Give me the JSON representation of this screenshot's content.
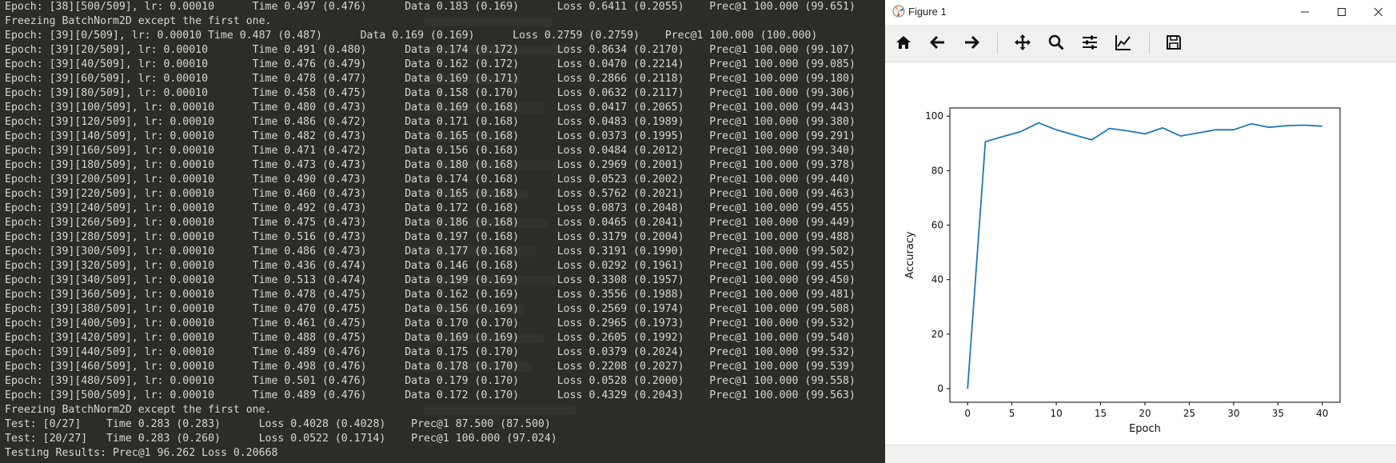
{
  "terminal": {
    "lines": [
      "Epoch: [38][500/509], lr: 0.00010      Time 0.497 (0.476)      Data 0.183 (0.169)      Loss 0.6411 (0.2055)    Prec@1 100.000 (99.651)",
      "Freezing BatchNorm2D except the first one.",
      "Epoch: [39][0/509], lr: 0.00010 Time 0.487 (0.487)      Data 0.169 (0.169)      Loss 0.2759 (0.2759)    Prec@1 100.000 (100.000)",
      "Epoch: [39][20/509], lr: 0.00010       Time 0.491 (0.480)      Data 0.174 (0.172)      Loss 0.8634 (0.2170)    Prec@1 100.000 (99.107)",
      "Epoch: [39][40/509], lr: 0.00010       Time 0.476 (0.479)      Data 0.162 (0.172)      Loss 0.0470 (0.2214)    Prec@1 100.000 (99.085)",
      "Epoch: [39][60/509], lr: 0.00010       Time 0.478 (0.477)      Data 0.169 (0.171)      Loss 0.2866 (0.2118)    Prec@1 100.000 (99.180)",
      "Epoch: [39][80/509], lr: 0.00010       Time 0.458 (0.475)      Data 0.158 (0.170)      Loss 0.0632 (0.2117)    Prec@1 100.000 (99.306)",
      "Epoch: [39][100/509], lr: 0.00010      Time 0.480 (0.473)      Data 0.169 (0.168)      Loss 0.0417 (0.2065)    Prec@1 100.000 (99.443)",
      "Epoch: [39][120/509], lr: 0.00010      Time 0.486 (0.472)      Data 0.171 (0.168)      Loss 0.0483 (0.1989)    Prec@1 100.000 (99.380)",
      "Epoch: [39][140/509], lr: 0.00010      Time 0.482 (0.473)      Data 0.165 (0.168)      Loss 0.0373 (0.1995)    Prec@1 100.000 (99.291)",
      "Epoch: [39][160/509], lr: 0.00010      Time 0.471 (0.472)      Data 0.156 (0.168)      Loss 0.0484 (0.2012)    Prec@1 100.000 (99.340)",
      "Epoch: [39][180/509], lr: 0.00010      Time 0.473 (0.473)      Data 0.180 (0.168)      Loss 0.2969 (0.2001)    Prec@1 100.000 (99.378)",
      "Epoch: [39][200/509], lr: 0.00010      Time 0.490 (0.473)      Data 0.174 (0.168)      Loss 0.0523 (0.2002)    Prec@1 100.000 (99.440)",
      "Epoch: [39][220/509], lr: 0.00010      Time 0.460 (0.473)      Data 0.165 (0.168)      Loss 0.5762 (0.2021)    Prec@1 100.000 (99.463)",
      "Epoch: [39][240/509], lr: 0.00010      Time 0.492 (0.473)      Data 0.172 (0.168)      Loss 0.0873 (0.2048)    Prec@1 100.000 (99.455)",
      "Epoch: [39][260/509], lr: 0.00010      Time 0.475 (0.473)      Data 0.186 (0.168)      Loss 0.0465 (0.2041)    Prec@1 100.000 (99.449)",
      "Epoch: [39][280/509], lr: 0.00010      Time 0.516 (0.473)      Data 0.197 (0.168)      Loss 0.3179 (0.2004)    Prec@1 100.000 (99.488)",
      "Epoch: [39][300/509], lr: 0.00010      Time 0.486 (0.473)      Data 0.177 (0.168)      Loss 0.3191 (0.1990)    Prec@1 100.000 (99.502)",
      "Epoch: [39][320/509], lr: 0.00010      Time 0.436 (0.474)      Data 0.146 (0.168)      Loss 0.0292 (0.1961)    Prec@1 100.000 (99.455)",
      "Epoch: [39][340/509], lr: 0.00010      Time 0.513 (0.474)      Data 0.199 (0.169)      Loss 0.3308 (0.1957)    Prec@1 100.000 (99.450)",
      "Epoch: [39][360/509], lr: 0.00010      Time 0.478 (0.475)      Data 0.162 (0.169)      Loss 0.3556 (0.1988)    Prec@1 100.000 (99.481)",
      "Epoch: [39][380/509], lr: 0.00010      Time 0.470 (0.475)      Data 0.156 (0.169)      Loss 0.2569 (0.1974)    Prec@1 100.000 (99.508)",
      "Epoch: [39][400/509], lr: 0.00010      Time 0.461 (0.475)      Data 0.170 (0.170)      Loss 0.2965 (0.1973)    Prec@1 100.000 (99.532)",
      "Epoch: [39][420/509], lr: 0.00010      Time 0.488 (0.475)      Data 0.169 (0.169)      Loss 0.2605 (0.1992)    Prec@1 100.000 (99.540)",
      "Epoch: [39][440/509], lr: 0.00010      Time 0.489 (0.476)      Data 0.175 (0.170)      Loss 0.0379 (0.2024)    Prec@1 100.000 (99.532)",
      "Epoch: [39][460/509], lr: 0.00010      Time 0.498 (0.476)      Data 0.178 (0.170)      Loss 0.2208 (0.2027)    Prec@1 100.000 (99.539)",
      "Epoch: [39][480/509], lr: 0.00010      Time 0.501 (0.476)      Data 0.179 (0.170)      Loss 0.0528 (0.2000)    Prec@1 100.000 (99.558)",
      "Epoch: [39][500/509], lr: 0.00010      Time 0.489 (0.476)      Data 0.172 (0.170)      Loss 0.4329 (0.2043)    Prec@1 100.000 (99.563)",
      "Freezing BatchNorm2D except the first one.",
      "Test: [0/27]    Time 0.283 (0.283)      Loss 0.4028 (0.4028)    Prec@1 87.500 (87.500)",
      "Test: [20/27]   Time 0.283 (0.260)      Loss 0.0522 (0.1714)    Prec@1 100.000 (97.024)",
      "Testing Results: Prec@1 96.262 Loss 0.20668"
    ]
  },
  "figure": {
    "title": "Figure 1",
    "toolbar": [
      {
        "name": "home-icon",
        "icon": "home"
      },
      {
        "name": "back-icon",
        "icon": "arrow-left"
      },
      {
        "name": "forward-icon",
        "icon": "arrow-right"
      },
      {
        "name": "pan-icon",
        "icon": "move"
      },
      {
        "name": "zoom-icon",
        "icon": "magnifier"
      },
      {
        "name": "configure-subplots-icon",
        "icon": "sliders"
      },
      {
        "name": "edit-axis-icon",
        "icon": "line-chart"
      },
      {
        "name": "save-icon",
        "icon": "floppy-disk"
      }
    ]
  },
  "chart_data": {
    "type": "line",
    "title": "",
    "xlabel": "Epoch",
    "ylabel": "Accuracy",
    "xlim": [
      -2,
      42
    ],
    "ylim": [
      -5,
      103
    ],
    "x_ticks": [
      "0",
      "5",
      "10",
      "15",
      "20",
      "25",
      "30",
      "35",
      "40"
    ],
    "y_ticks": [
      "0",
      "20",
      "40",
      "60",
      "80",
      "100"
    ],
    "grid": false,
    "line_color": "#1f77b4",
    "series": [
      {
        "x": [
          0,
          2,
          4,
          6,
          8,
          10,
          12,
          14,
          16,
          18,
          20,
          22,
          24,
          26,
          28,
          30,
          32,
          34,
          36,
          38,
          40
        ],
        "values": [
          0,
          90.6,
          92.5,
          94.3,
          97.5,
          95,
          93.1,
          91.3,
          95.5,
          94.6,
          93.5,
          95.7,
          92.7,
          93.8,
          95,
          95,
          97.2,
          95.9,
          96.5,
          96.7,
          96.3
        ]
      }
    ]
  }
}
